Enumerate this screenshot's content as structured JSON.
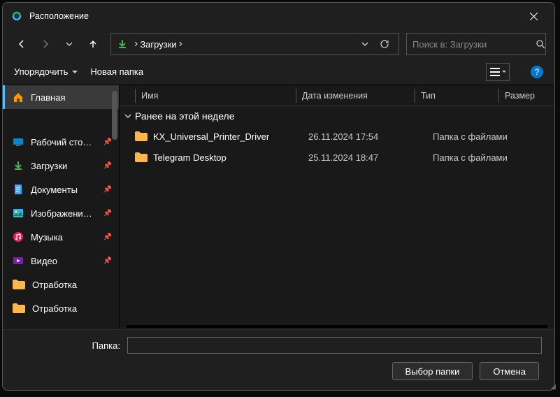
{
  "window": {
    "title": "Расположение"
  },
  "path": {
    "crumb": "Загрузки"
  },
  "search": {
    "placeholder": "Поиск в: Загрузки"
  },
  "toolbar": {
    "organize": "Упорядочить",
    "newfolder": "Новая папка"
  },
  "sidebar": {
    "home": "Главная",
    "items": [
      {
        "label": "Рабочий сто…"
      },
      {
        "label": "Загрузки"
      },
      {
        "label": "Документы"
      },
      {
        "label": "Изображени…"
      },
      {
        "label": "Музыка"
      },
      {
        "label": "Видео"
      },
      {
        "label": "Отработка"
      },
      {
        "label": "Отработка"
      }
    ]
  },
  "columns": {
    "name": "Имя",
    "date": "Дата изменения",
    "type": "Тип",
    "size": "Размер"
  },
  "group": "Ранее на этой неделе",
  "rows": [
    {
      "name": "KX_Universal_Printer_Driver",
      "date": "26.11.2024 17:54",
      "type": "Папка с файлами"
    },
    {
      "name": "Telegram Desktop",
      "date": "25.11.2024 18:47",
      "type": "Папка с файлами"
    }
  ],
  "footer": {
    "folderLabel": "Папка:",
    "folderValue": "",
    "select": "Выбор папки",
    "cancel": "Отмена"
  }
}
